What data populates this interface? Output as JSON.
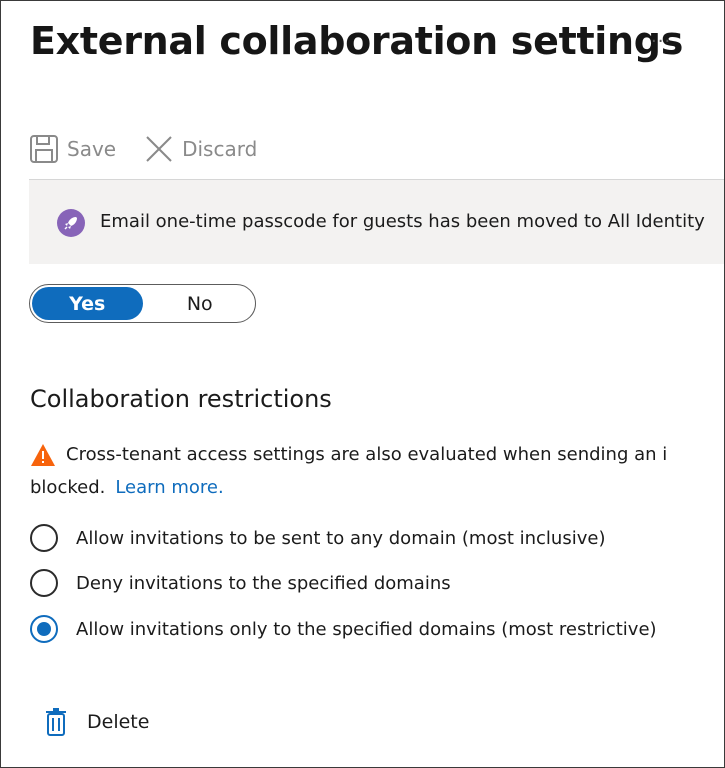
{
  "header": {
    "title": "External collaboration settings",
    "more_label": "···"
  },
  "toolbar": {
    "save_label": "Save",
    "discard_label": "Discard"
  },
  "banner": {
    "text": "Email one-time passcode for guests has been moved to All Identity"
  },
  "toggle": {
    "yes_label": "Yes",
    "no_label": "No",
    "selected": "Yes"
  },
  "restrictions": {
    "title": "Collaboration restrictions",
    "warning_line1": "Cross-tenant access settings are also evaluated when sending an i",
    "warning_line2": "blocked.",
    "learn_more": "Learn more.",
    "options": [
      {
        "label": "Allow invitations to be sent to any domain (most inclusive)",
        "checked": false
      },
      {
        "label": "Deny invitations to the specified domains",
        "checked": false
      },
      {
        "label": "Allow invitations only to the specified domains (most restrictive)",
        "checked": true
      }
    ]
  },
  "actions": {
    "delete_label": "Delete"
  },
  "colors": {
    "accent": "#0f6cbd",
    "banner_icon": "#8764b8",
    "warning": "#f7630c"
  }
}
